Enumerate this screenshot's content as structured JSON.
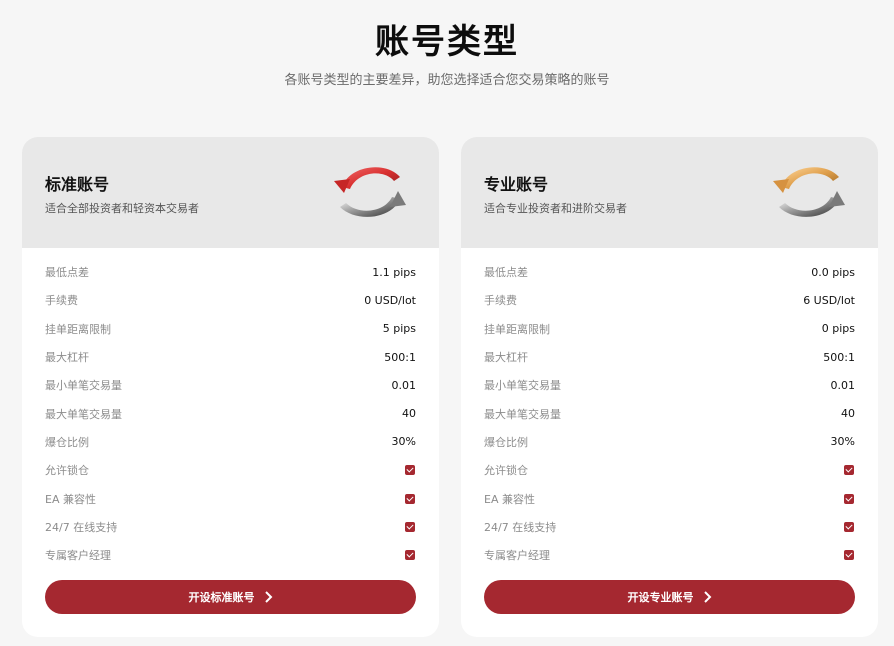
{
  "page": {
    "title": "账号类型",
    "subtitle": "各账号类型的主要差异，助您选择适合您交易策略的账号"
  },
  "colors": {
    "accent": "#a52830",
    "header_bg": "#e8e8e8",
    "page_bg": "#f6f6f6"
  },
  "cards": [
    {
      "title": "标准账号",
      "description": "适合全部投资者和轻资本交易者",
      "icon": "refresh-arrows-red-icon",
      "rows": [
        {
          "label": "最低点差",
          "value": "1.1 pips"
        },
        {
          "label": "手续费",
          "value": "0 USD/lot"
        },
        {
          "label": "挂单距离限制",
          "value": "5 pips"
        },
        {
          "label": "最大杠杆",
          "value": "500:1"
        },
        {
          "label": "最小单笔交易量",
          "value": "0.01"
        },
        {
          "label": "最大单笔交易量",
          "value": "40"
        },
        {
          "label": "爆仓比例",
          "value": "30%"
        },
        {
          "label": "允许锁仓",
          "value": "check-icon"
        },
        {
          "label": "EA 兼容性",
          "value": "check-icon"
        },
        {
          "label": "24/7 在线支持",
          "value": "check-icon"
        },
        {
          "label": "专属客户经理",
          "value": "check-icon"
        }
      ],
      "button_label": "开设标准账号"
    },
    {
      "title": "专业账号",
      "description": "适合专业投资者和进阶交易者",
      "icon": "refresh-arrows-gold-icon",
      "rows": [
        {
          "label": "最低点差",
          "value": "0.0 pips"
        },
        {
          "label": "手续费",
          "value": "6 USD/lot"
        },
        {
          "label": "挂单距离限制",
          "value": "0 pips"
        },
        {
          "label": "最大杠杆",
          "value": "500:1"
        },
        {
          "label": "最小单笔交易量",
          "value": "0.01"
        },
        {
          "label": "最大单笔交易量",
          "value": "40"
        },
        {
          "label": "爆仓比例",
          "value": "30%"
        },
        {
          "label": "允许锁仓",
          "value": "check-icon"
        },
        {
          "label": "EA 兼容性",
          "value": "check-icon"
        },
        {
          "label": "24/7 在线支持",
          "value": "check-icon"
        },
        {
          "label": "专属客户经理",
          "value": "check-icon"
        }
      ],
      "button_label": "开设专业账号"
    }
  ]
}
